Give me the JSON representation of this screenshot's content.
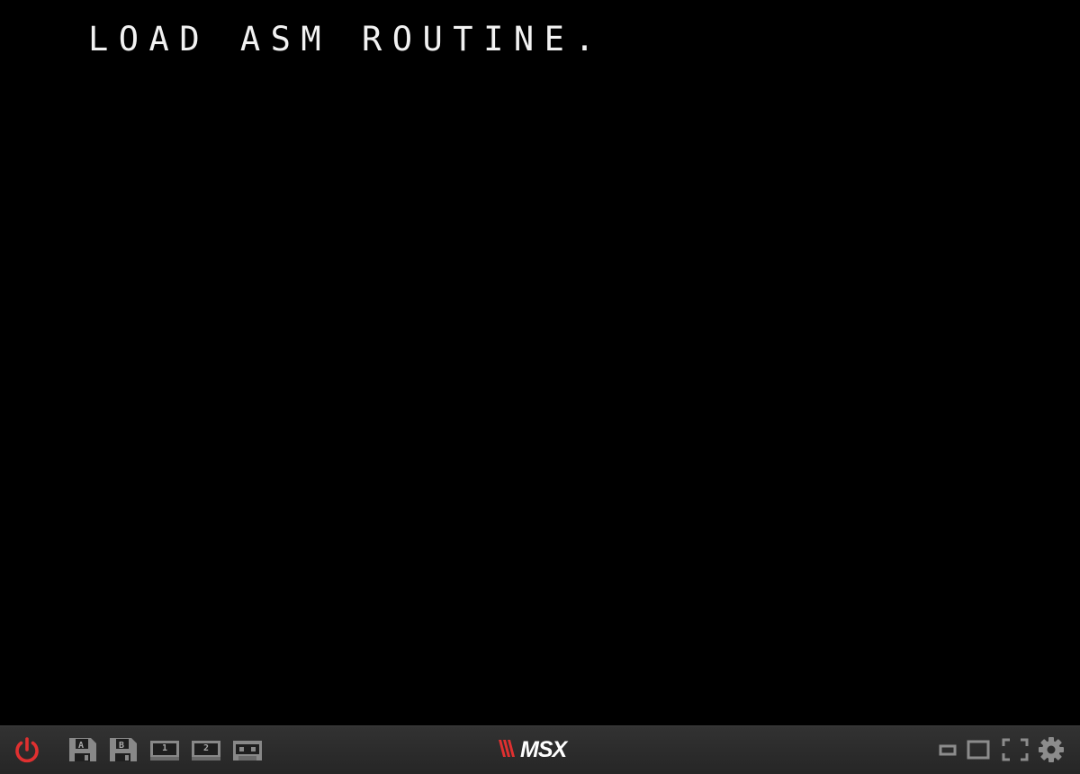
{
  "screen": {
    "text": "LOAD ASM ROUTINE.",
    "background": "#000000",
    "text_color": "#f2f2f2"
  },
  "toolbar": {
    "power_button": {
      "icon": "power-icon",
      "color": "#e03030"
    },
    "media_buttons": [
      {
        "id": "disk-a",
        "icon": "floppy-disk-icon",
        "label": "A"
      },
      {
        "id": "disk-b",
        "icon": "floppy-disk-icon",
        "label": "B"
      },
      {
        "id": "cartridge-1",
        "icon": "cartridge-icon",
        "label": "1"
      },
      {
        "id": "cartridge-2",
        "icon": "cartridge-icon",
        "label": "2"
      },
      {
        "id": "tape",
        "icon": "cassette-tape-icon",
        "label": ""
      }
    ],
    "logo": {
      "mark_color": "#e03030",
      "text": "MSX"
    },
    "view_buttons": [
      {
        "id": "small-window",
        "icon": "small-screen-icon"
      },
      {
        "id": "medium-window",
        "icon": "medium-screen-icon"
      },
      {
        "id": "fullscreen",
        "icon": "fullscreen-icon"
      },
      {
        "id": "settings",
        "icon": "gear-icon"
      }
    ],
    "icon_color": "#8c8c8c",
    "background": "#2b2b2b"
  }
}
